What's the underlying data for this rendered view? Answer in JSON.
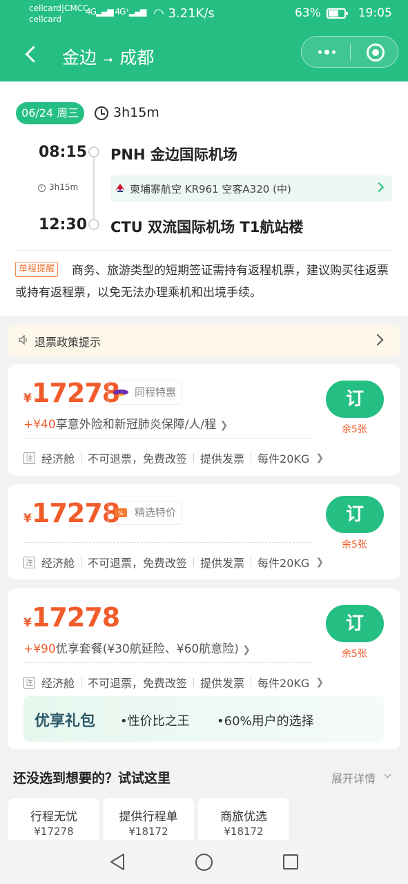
{
  "status_bar": {
    "carrier_line1": "cellcard|CMCC",
    "carrier_line2": "cellcard",
    "signal1": "4G",
    "signal2": "4G⁺",
    "speed": "3.21K/s",
    "battery": "63%",
    "battery_level": 0.63,
    "time": "19:05"
  },
  "header": {
    "origin": "金边",
    "arrow": "→",
    "destination": "成都"
  },
  "flight": {
    "date_badge": "06/24 周三",
    "duration": "3h15m",
    "dep_time": "08:15",
    "dep_airport": "PNH 金边国际机场",
    "mid_duration": "3h15m",
    "airline_info": "柬埔寨航空 KR961 空客A320 (中)",
    "arr_time": "12:30",
    "arr_airport": "CTU 双流国际机场 T1航站楼",
    "oneway_tag": "单程提醒",
    "notice": "商务、旅游类型的短期签证需持有返程机票，建议购买往返票或持有返程票，以免无法办理乘机和出境手续。"
  },
  "refund_banner": {
    "label": "退票政策提示"
  },
  "offers": [
    {
      "currency": "¥",
      "price": "17278",
      "promo": "同程特惠",
      "addon_prefix": "+¥40",
      "addon_text": "享意外险和新冠肺炎保障/人/程",
      "cabin": "经济舱",
      "refund": "不可退票，免费改签",
      "invoice": "提供发票",
      "baggage": "每件20KG",
      "book": "订",
      "remain": "余5张"
    },
    {
      "currency": "¥",
      "price": "17278",
      "promo": "精选特价",
      "cabin": "经济舱",
      "refund": "不可退票，免费改签",
      "invoice": "提供发票",
      "baggage": "每件20KG",
      "book": "订",
      "remain": "余5张"
    },
    {
      "currency": "¥",
      "price": "17278",
      "addon_prefix": "+¥90",
      "addon_text": "优享套餐(¥30航延险、¥60航意险)",
      "cabin": "经济舱",
      "refund": "不可退票，免费改签",
      "invoice": "提供发票",
      "baggage": "每件20KG",
      "book": "订",
      "remain": "余5张",
      "gift_title": "优享礼包",
      "gift_b1": "•性价比之王",
      "gift_b2": "•60%用户的选择"
    }
  ],
  "alternatives": {
    "title": "还没选到想要的？试试这里",
    "expand": "展开详情",
    "items": [
      {
        "label": "行程无忧",
        "price": "¥17278"
      },
      {
        "label": "提供行程单",
        "price": "¥18172"
      },
      {
        "label": "商旅优选",
        "price": "¥18172"
      }
    ]
  },
  "colors": {
    "brand_green": "#25bf83",
    "price_orange": "#f25c2b"
  },
  "icons": [
    "back-icon",
    "more-dots-icon",
    "close-circle-icon",
    "clock-icon",
    "airline-logo-icon",
    "chevron-right-icon",
    "speaker-icon",
    "note-icon",
    "nav-back-icon",
    "nav-home-icon",
    "nav-recent-icon"
  ]
}
